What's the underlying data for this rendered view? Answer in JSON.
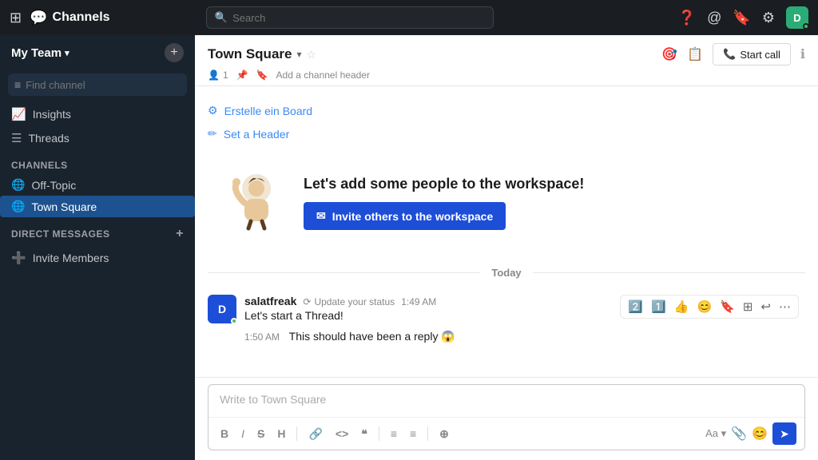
{
  "topbar": {
    "app_name": "Channels",
    "search_placeholder": "Search",
    "help_icon": "?",
    "avatar_initials": "D",
    "avatar_color": "#2bac76"
  },
  "sidebar": {
    "team_name": "My Team",
    "find_channel_placeholder": "Find channel",
    "nav_items": [
      {
        "label": "Insights",
        "icon": "📈"
      },
      {
        "label": "Threads",
        "icon": "☰"
      }
    ],
    "channels_header": "CHANNELS",
    "channels": [
      {
        "label": "Off-Topic",
        "active": false
      },
      {
        "label": "Town Square",
        "active": true
      }
    ],
    "dm_header": "DIRECT MESSAGES",
    "invite_label": "Invite Members"
  },
  "channel": {
    "title": "Town Square",
    "start_call_label": "Start call",
    "add_header_label": "Add a channel header",
    "member_count": "1",
    "action1": "Erstelle ein Board",
    "action2": "Set a Header",
    "promo_heading": "Let's add some people to the workspace!",
    "invite_btn_label": "Invite others to the workspace",
    "today_label": "Today",
    "message": {
      "author": "salatfreak",
      "status": "Update your status",
      "time": "1:49 AM",
      "text": "Let's start a Thread!",
      "reply_time": "1:50 AM",
      "reply_text": "This should have been a reply 😱"
    }
  },
  "compose": {
    "placeholder": "Write to Town Square",
    "toolbar": {
      "bold": "B",
      "italic": "I",
      "strike": "S",
      "heading": "H",
      "link": "🔗",
      "code": "<>",
      "quote": "❝",
      "bullet": "≡",
      "numbered": "≡",
      "more": "⊕",
      "aa_label": "Aa",
      "send_icon": "➤"
    }
  }
}
